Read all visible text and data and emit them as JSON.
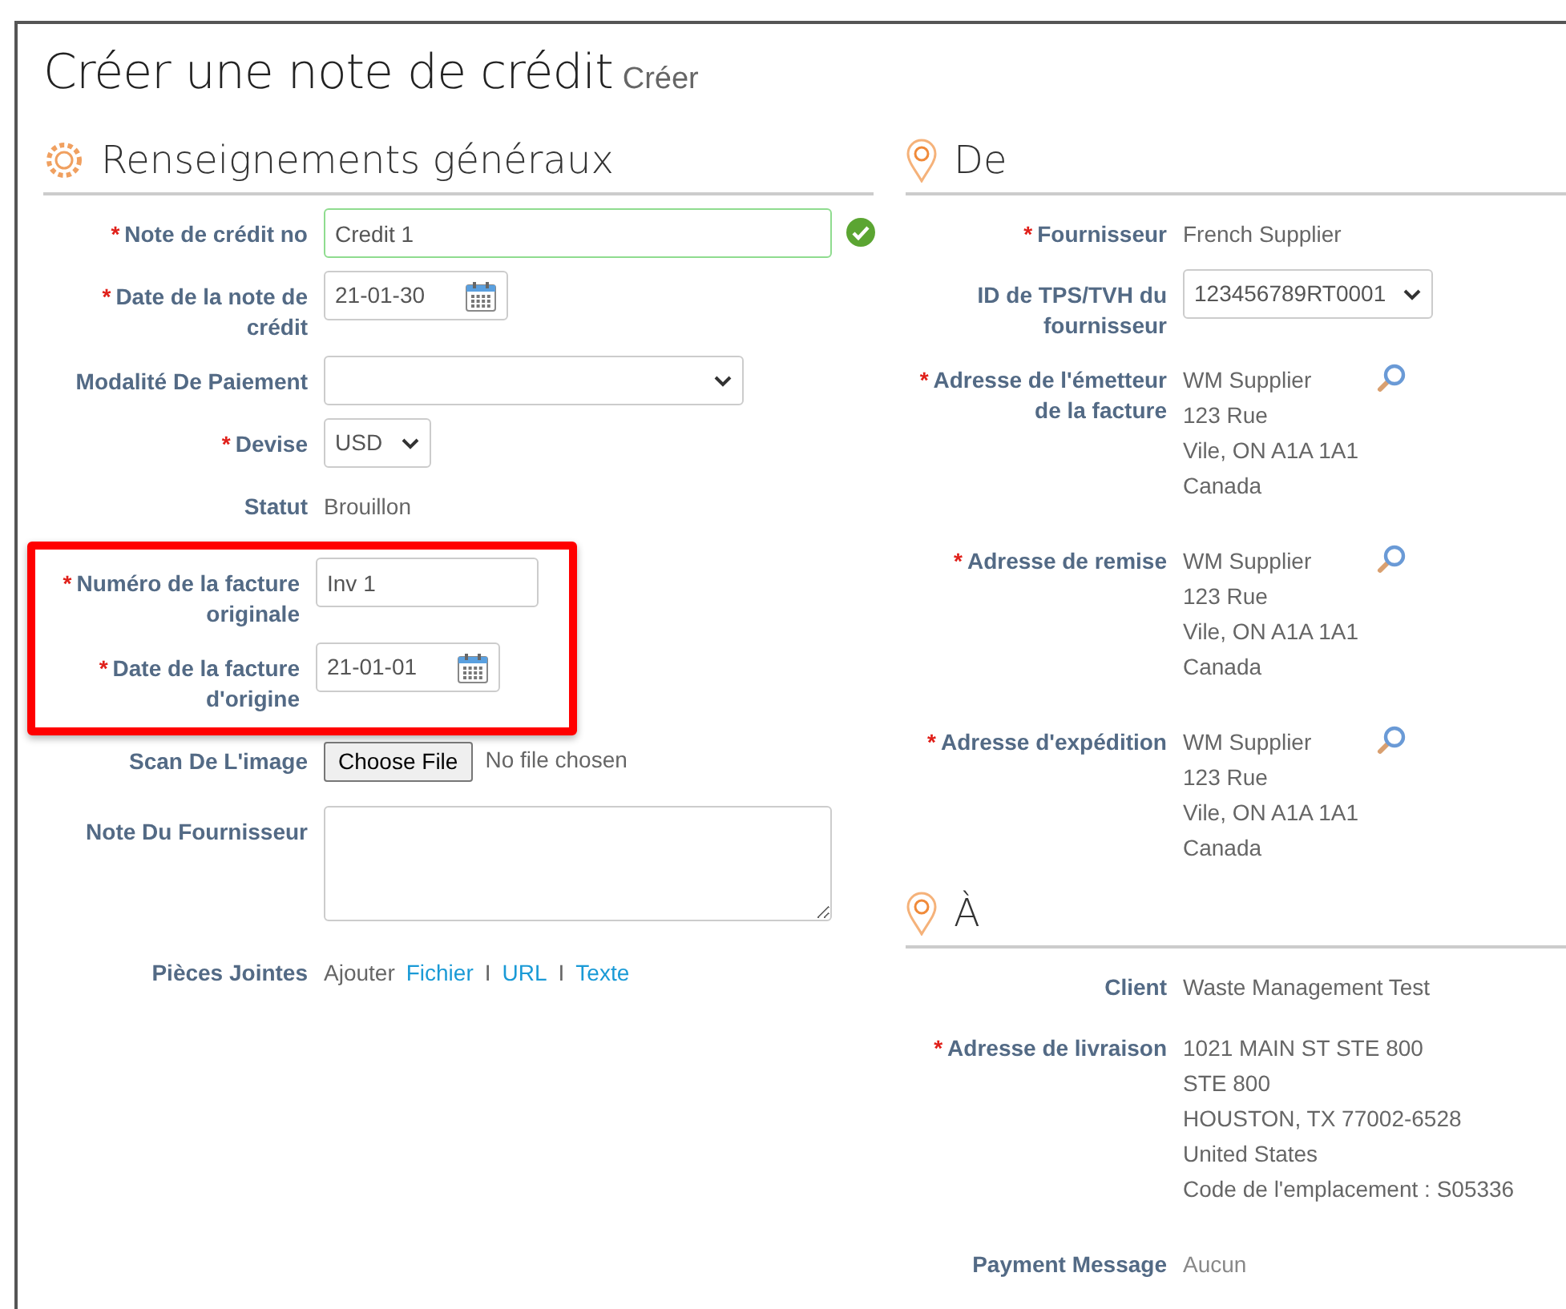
{
  "title": "Créer une note de crédit",
  "subtitle": "Créer",
  "required_marker": "*",
  "left": {
    "heading": "Renseignements généraux",
    "fields": [
      {
        "kind": "input",
        "label": "Note de crédit no",
        "required": true,
        "value": "Credit 1",
        "valid": true,
        "highlighted": false
      },
      {
        "kind": "date",
        "label": "Date de la note de crédit",
        "required": true,
        "value": "21-01-30",
        "highlighted": false
      },
      {
        "kind": "select",
        "label": "Modalité De Paiement",
        "required": false,
        "highlighted": false
      },
      {
        "kind": "select_small",
        "label": "Devise",
        "required": true,
        "value": "USD",
        "highlighted": false
      },
      {
        "kind": "static",
        "label": "Statut",
        "required": false,
        "value": "Brouillon",
        "highlighted": false
      },
      {
        "kind": "input",
        "label": "Numéro de la facture originale",
        "required": true,
        "value": "Inv 1",
        "valid": false,
        "highlighted": true
      },
      {
        "kind": "date",
        "label": "Date de la facture d'origine",
        "required": true,
        "value": "21-01-01",
        "highlighted": true
      },
      {
        "kind": "file",
        "label": "Scan De L'image",
        "required": false,
        "button": "Choose File",
        "note": "No file chosen",
        "highlighted": false
      },
      {
        "kind": "textarea",
        "label": "Note Du Fournisseur",
        "required": false,
        "highlighted": false
      },
      {
        "kind": "attachments",
        "label": "Pièces Jointes",
        "required": false,
        "prefix": "Ajouter",
        "separators": [
          "I",
          "I"
        ],
        "links": [
          "Fichier",
          "URL",
          "Texte"
        ],
        "highlighted": false
      }
    ]
  },
  "right": [
    {
      "heading": "De",
      "fields": [
        {
          "kind": "static",
          "label": "Fournisseur",
          "required": true,
          "value": "French Supplier"
        },
        {
          "kind": "select_medium",
          "label": "ID de TPS/TVH du fournisseur",
          "required": false,
          "value": "123456789RT0001"
        },
        {
          "kind": "address",
          "label": "Adresse de l'émetteur de la facture",
          "required": true,
          "lookup": true,
          "lines": [
            "WM Supplier",
            "123 Rue",
            "Vile, ON A1A 1A1",
            "Canada"
          ]
        },
        {
          "kind": "address",
          "label": "Adresse de remise",
          "required": true,
          "lookup": true,
          "lines": [
            "WM Supplier",
            "123 Rue",
            "Vile, ON A1A 1A1",
            "Canada"
          ]
        },
        {
          "kind": "address",
          "label": "Adresse d'expédition",
          "required": true,
          "lookup": true,
          "lines": [
            "WM Supplier",
            "123 Rue",
            "Vile, ON A1A 1A1",
            "Canada"
          ]
        }
      ]
    },
    {
      "heading": "À",
      "fields": [
        {
          "kind": "static",
          "label": "Client",
          "required": false,
          "value": "Waste Management Test"
        },
        {
          "kind": "address",
          "label": "Adresse de livraison",
          "required": true,
          "lookup": false,
          "lines": [
            "1021 MAIN ST STE 800",
            "STE 800",
            "HOUSTON, TX 77002-6528",
            "United States",
            "Code de l'emplacement : S05336"
          ]
        },
        {
          "kind": "static_muted",
          "label": "Payment Message",
          "required": false,
          "value": "Aucun"
        }
      ]
    }
  ]
}
